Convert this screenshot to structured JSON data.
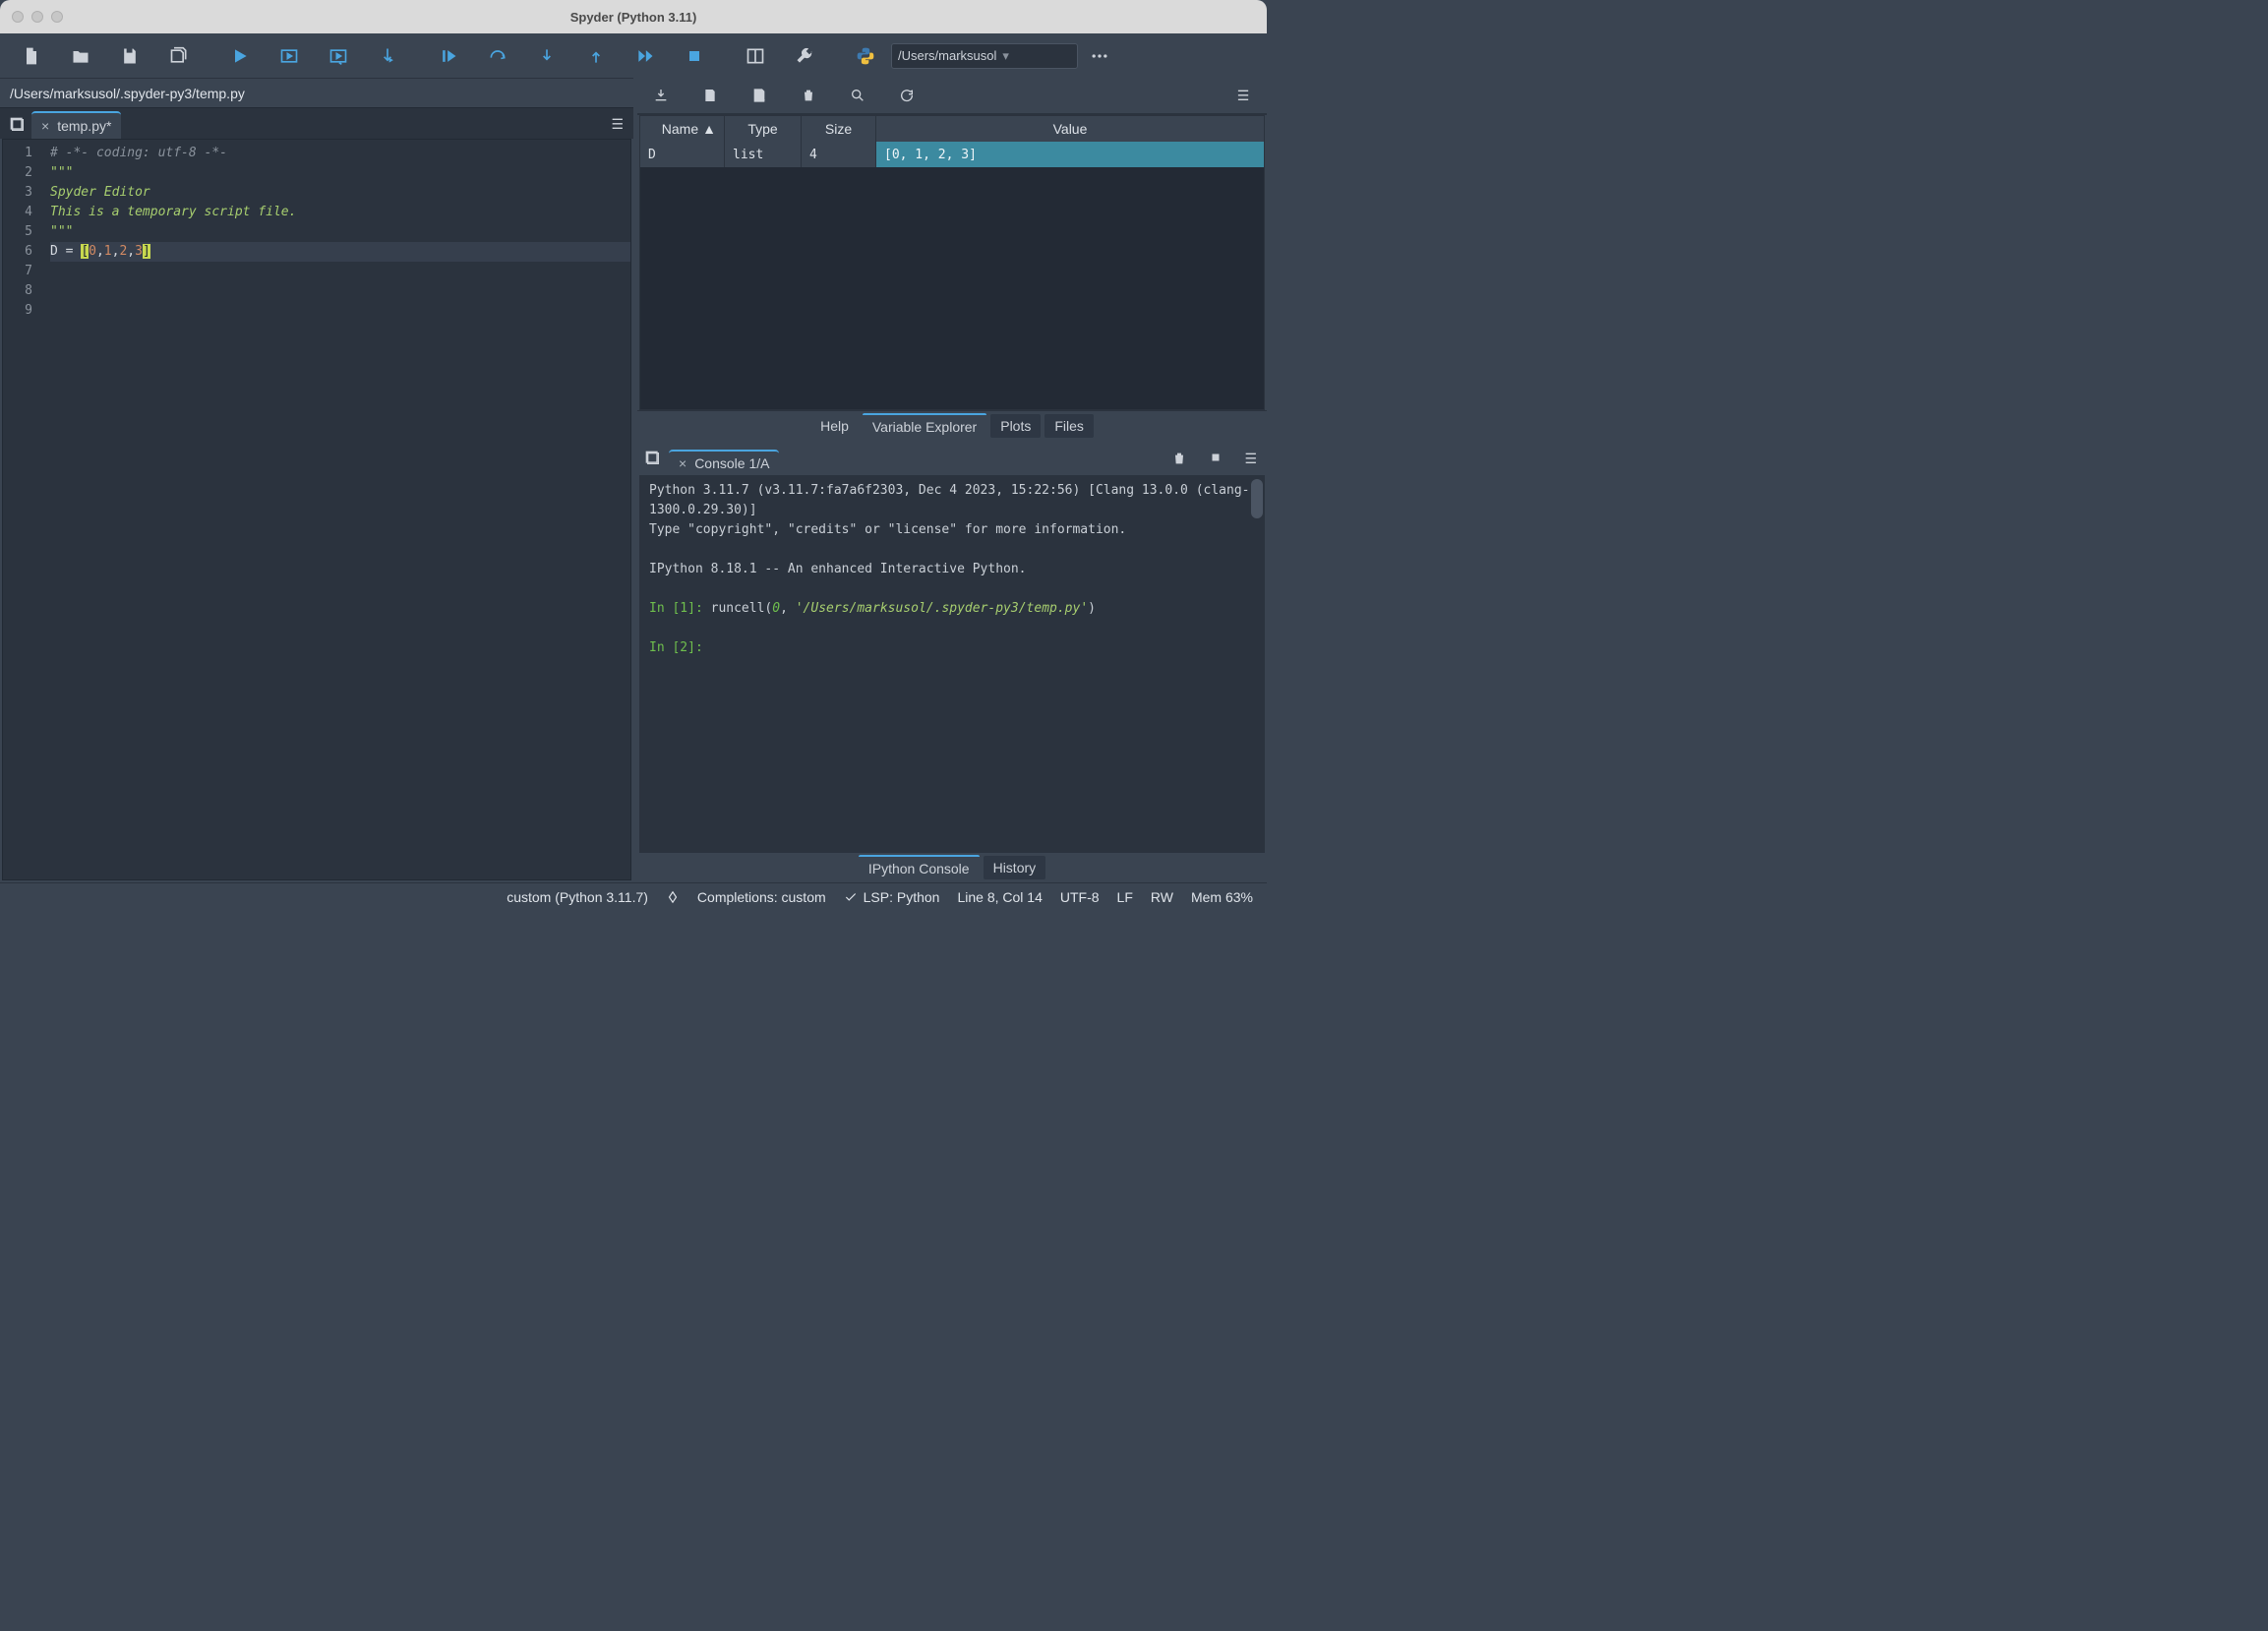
{
  "window": {
    "title": "Spyder (Python 3.11)"
  },
  "working_dir": "/Users/marksusol",
  "breadcrumb": "/Users/marksusol/.spyder-py3/temp.py",
  "editor": {
    "tab_label": "temp.py*",
    "lines": {
      "l1": "# -*- coding: utf-8 -*-",
      "l2": "\"\"\"",
      "l3": "Spyder Editor",
      "l4": "",
      "l5": "This is a temporary script file.",
      "l6": "\"\"\"",
      "l7": "",
      "l8_var": "D",
      "l8_op": " = ",
      "l8_lb": "[",
      "l8_n0": "0",
      "l8_c0": ",",
      "l8_n1": "1",
      "l8_c1": ",",
      "l8_n2": "2",
      "l8_c2": ",",
      "l8_n3": "3",
      "l8_rb": "]",
      "l9": ""
    },
    "line_numbers": [
      "1",
      "2",
      "3",
      "4",
      "5",
      "6",
      "7",
      "8",
      "9"
    ]
  },
  "var_explorer": {
    "headers": {
      "name": "Name",
      "type": "Type",
      "size": "Size",
      "value": "Value"
    },
    "rows": [
      {
        "name": "D",
        "type": "list",
        "size": "4",
        "value": "[0, 1, 2, 3]"
      }
    ]
  },
  "right_tabs": {
    "help": "Help",
    "ve": "Variable Explorer",
    "plots": "Plots",
    "files": "Files"
  },
  "console": {
    "tab_label": "Console 1/A",
    "banner1": "Python 3.11.7 (v3.11.7:fa7a6f2303, Dec  4 2023, 15:22:56) [Clang 13.0.0 (clang-1300.0.29.30)]",
    "banner2": "Type \"copyright\", \"credits\" or \"license\" for more information.",
    "banner3": "IPython 8.18.1 -- An enhanced Interactive Python.",
    "in1_prompt": "In [1]: ",
    "in1_call": "runcell(",
    "in1_arg0": "0",
    "in1_comma": ", ",
    "in1_path": "'/Users/marksusol/.spyder-py3/temp.py'",
    "in1_close": ")",
    "in2_prompt": "In [2]: "
  },
  "console_tabs": {
    "ipy": "IPython Console",
    "hist": "History"
  },
  "statusbar": {
    "interpreter": "custom (Python 3.11.7)",
    "completions": "Completions: custom",
    "lsp": "LSP: Python",
    "cursor": "Line 8, Col 14",
    "encoding": "UTF-8",
    "eol": "LF",
    "perm": "RW",
    "mem": "Mem 63%"
  }
}
